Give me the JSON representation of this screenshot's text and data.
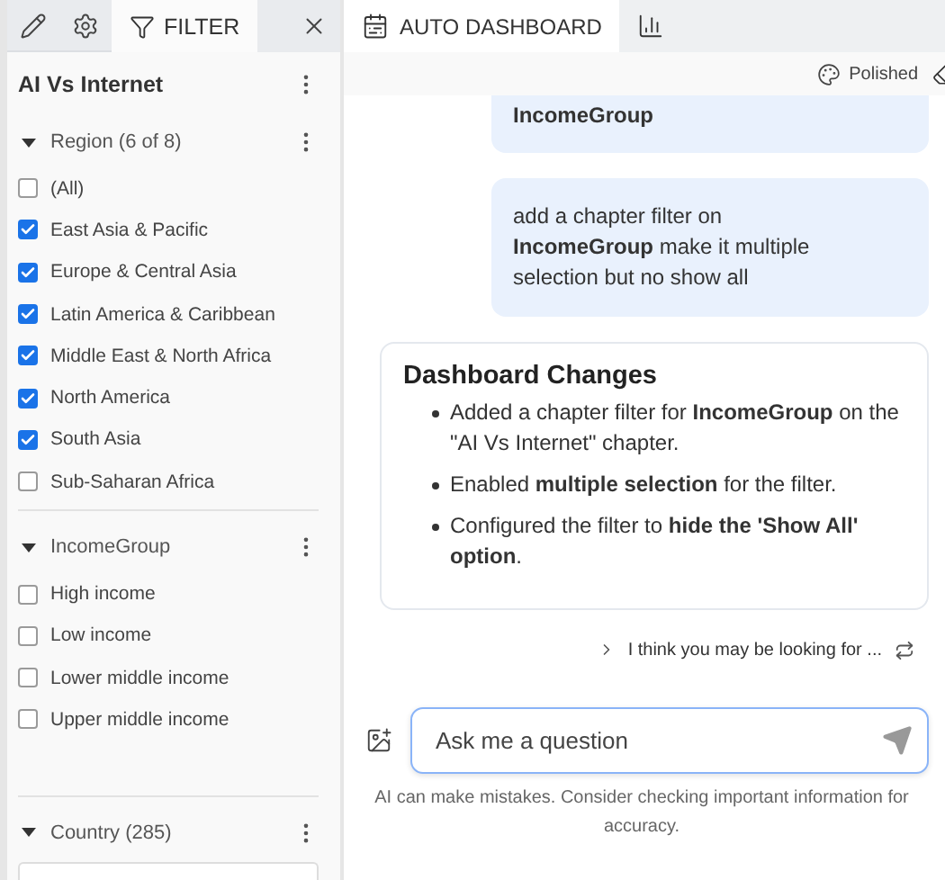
{
  "left_tabs": [
    {
      "kind": "edit",
      "selected": false
    },
    {
      "kind": "settings",
      "selected": false
    },
    {
      "kind": "filter",
      "label": "FILTER",
      "selected": true
    }
  ],
  "chapter": {
    "title": "AI Vs Internet"
  },
  "filters": [
    {
      "title": "Region (6 of 8)",
      "expanded": true,
      "options": [
        {
          "label": "(All)",
          "checked": false
        },
        {
          "label": "East Asia & Pacific",
          "checked": true
        },
        {
          "label": "Europe & Central Asia",
          "checked": true
        },
        {
          "label": "Latin America & Caribbean",
          "checked": true
        },
        {
          "label": "Middle East & North Africa",
          "checked": true
        },
        {
          "label": "North America",
          "checked": true
        },
        {
          "label": "South Asia",
          "checked": true
        },
        {
          "label": "Sub-Saharan Africa",
          "checked": false
        }
      ]
    },
    {
      "title": "IncomeGroup",
      "expanded": true,
      "options": [
        {
          "label": "High income",
          "checked": false
        },
        {
          "label": "Low income",
          "checked": false
        },
        {
          "label": "Lower middle income",
          "checked": false
        },
        {
          "label": "Upper middle income",
          "checked": false
        }
      ]
    },
    {
      "title": "Country (285)",
      "expanded": true
    }
  ],
  "right_tabs": [
    {
      "kind": "dashboard",
      "label": "AUTO DASHBOARD",
      "selected": true
    },
    {
      "kind": "report",
      "selected": false
    }
  ],
  "toolbar": {
    "theme": "Polished"
  },
  "messages": [
    {
      "kind": "user",
      "text": "**IncomeGroup**"
    },
    {
      "kind": "user",
      "text": "add a chapter filter on **IncomeGroup** make it multiple selection but no show all"
    },
    {
      "kind": "card",
      "title": "Dashboard Changes",
      "bullets": [
        "Added a chapter filter for **IncomeGroup** on the \"AI Vs Internet\" chapter.",
        "Enabled **multiple selection** for the filter.",
        "Configured the filter to **hide the 'Show All' option**."
      ]
    }
  ],
  "suggestion": "I think you may be looking for ...",
  "input": {
    "placeholder": "Ask me a question"
  },
  "disclaimer": "AI can make mistakes. Consider checking important information for accuracy."
}
